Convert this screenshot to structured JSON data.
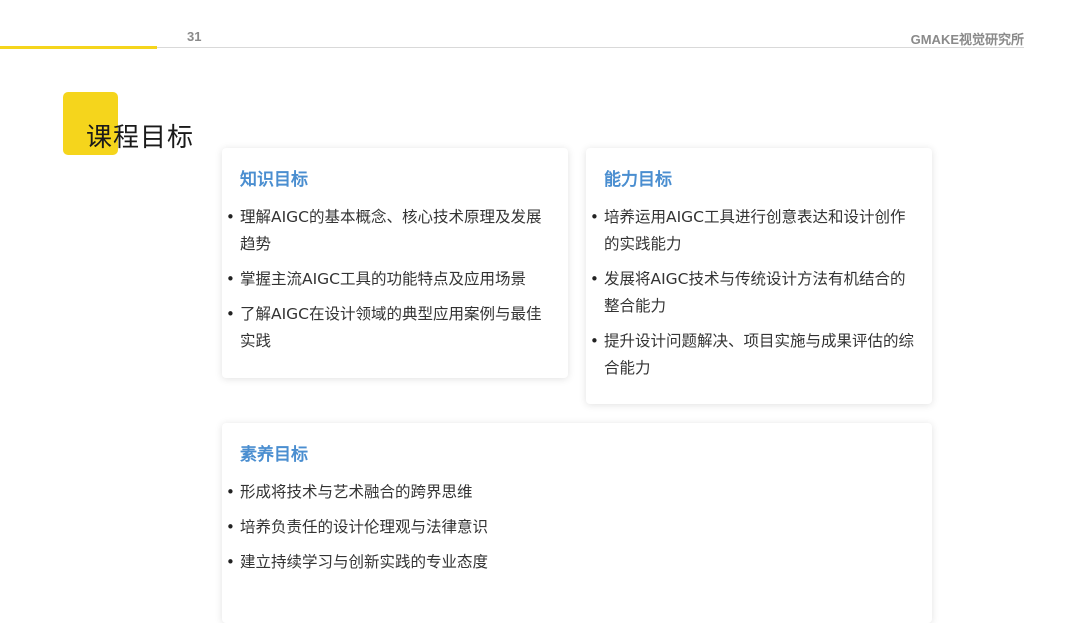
{
  "header": {
    "page_number": "31",
    "brand": "GMAKE视觉研究所"
  },
  "title": "课程目标",
  "cards": {
    "knowledge": {
      "title": "知识目标",
      "items": [
        "理解AIGC的基本概念、核心技术原理及发展趋势",
        "掌握主流AIGC工具的功能特点及应用场景",
        "了解AIGC在设计领域的典型应用案例与最佳实践"
      ]
    },
    "ability": {
      "title": "能力目标",
      "items": [
        "培养运用AIGC工具进行创意表达和设计创作的实践能力",
        "发展将AIGC技术与传统设计方法有机结合的整合能力",
        "提升设计问题解决、项目实施与成果评估的综合能力"
      ]
    },
    "literacy": {
      "title": "素养目标",
      "items": [
        "形成将技术与艺术融合的跨界思维",
        "培养负责任的设计伦理观与法律意识",
        "建立持续学习与创新实践的专业态度"
      ]
    }
  },
  "colors": {
    "accent": "#f5d51c",
    "card_title": "#4a8ed0",
    "body_text": "#333333"
  }
}
